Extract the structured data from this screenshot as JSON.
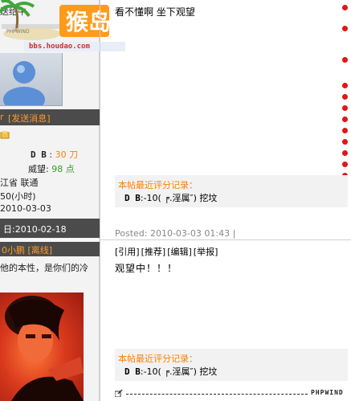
{
  "post1": {
    "sidebar": {
      "header_fragment": "送给牛",
      "logo": {
        "forum_name": "猴岛",
        "watermark": "PHPWIND",
        "url": "bbs.houdao.com"
      },
      "action_label": "[发送消息]",
      "db_label": "D B",
      "db_value": "30 刀",
      "prestige_label": "威望:",
      "prestige_value": "98 点",
      "location": "江省 联通",
      "online": "50(小时)",
      "date": "2010-03-03",
      "register": "日:2010-02-18"
    },
    "content": "看不懂啊 坐下观望",
    "rating": {
      "title": "本帖最近评分记录：",
      "label": "D B",
      "value": ":-10( ╒.淫属″) 挖坟"
    },
    "posted": "Posted: 2010-03-03 01:43 |"
  },
  "post2": {
    "sidebar": {
      "name": "0小鹏 [离线]",
      "signature": "他的本性，是你们的冷"
    },
    "ops": [
      "[引用]",
      "[推荐]",
      "[编辑]",
      "[举报]"
    ],
    "content": "观望中！！！",
    "rating": {
      "title": "本帖最近评分记录：",
      "label": "D B",
      "value": ":-10( ╒.淫属″) 挖坟"
    },
    "footer_brand": "PHPWIND"
  },
  "colors": {
    "accent": "#ff7f00",
    "dark_bar": "#4b4b4b",
    "dot": "#e21515"
  }
}
